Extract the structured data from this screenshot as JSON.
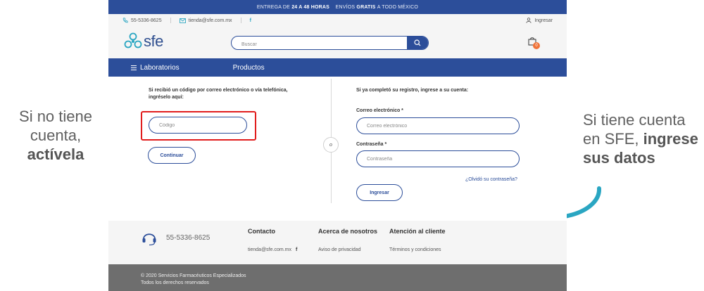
{
  "annotations": {
    "left_line1": "Si no tiene",
    "left_line2": "cuenta,",
    "left_bold": "actívela",
    "right_line1": "Si tiene cuenta",
    "right_line2": "en SFE,",
    "right_bold1": "ingrese",
    "right_bold2": "sus datos",
    "arrow_icon": "curved-arrow-icon"
  },
  "promo": {
    "text1": "ENTREGA DE",
    "bold1": "24 A 48 HORAS",
    "text2": "ENVÍOS",
    "bold2": "GRATIS",
    "text3": "A TODO MÉXICO"
  },
  "topbar": {
    "phone": "55-5336-8625",
    "email": "tienda@sfe.com.mx",
    "facebook": "f",
    "login": "Ingresar"
  },
  "header": {
    "logo": "sfe",
    "search_placeholder": "Buscar",
    "cart_count": "0"
  },
  "nav": {
    "items": [
      "Laboratorios",
      "Productos"
    ]
  },
  "activate": {
    "heading": "Si recibió un código por correo electrónico o vía telefónica, ingréselo aquí:",
    "code_placeholder": "Código",
    "continue_label": "Continuar"
  },
  "separator": "o",
  "login": {
    "heading": "Si ya completó su registro, ingrese a su cuenta:",
    "email_label": "Correo electrónico *",
    "email_placeholder": "Correo electrónico",
    "password_label": "Contraseña *",
    "password_placeholder": "Contraseña",
    "forgot": "¿Olvidó su contraseña?",
    "submit_label": "Ingresar"
  },
  "footer": {
    "phone": "55-5336-8625",
    "contact_title": "Contacto",
    "contact_email": "tienda@sfe.com.mx",
    "contact_facebook": "f",
    "about_title": "Acerca de nosotros",
    "about_link": "Aviso de privacidad",
    "support_title": "Atención al cliente",
    "support_link": "Términos y condiciones"
  },
  "copyright": {
    "line1": "© 2020 Servicios Farmacéuticos Especializados",
    "line2": "Todos los derechos reservados"
  },
  "colors": {
    "brand_blue": "#2c4e9a",
    "highlight_red": "#e11d1d",
    "cart_badge": "#f0743a",
    "arrow_teal": "#2aa6c2"
  }
}
